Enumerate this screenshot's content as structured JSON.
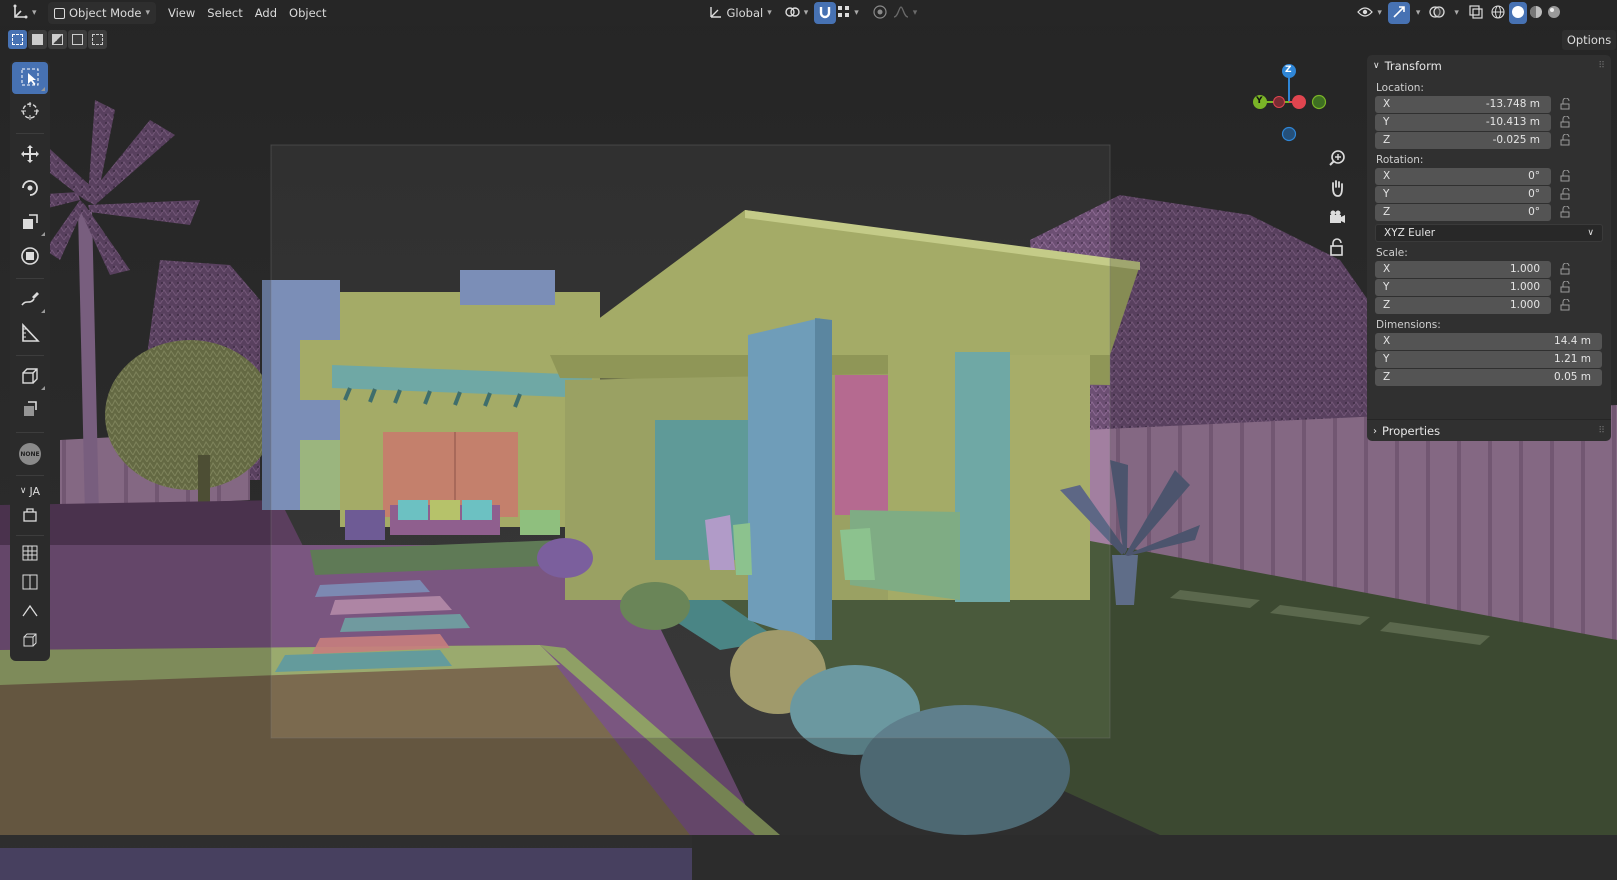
{
  "header": {
    "editor_type_icon": "axes-icon",
    "mode": "Object Mode",
    "menus": [
      "View",
      "Select",
      "Add",
      "Object"
    ],
    "transform_orientation": "Global",
    "options_button": "Options"
  },
  "toolbar": {
    "collapsed_label": "JA"
  },
  "gizmo": {
    "axis_z": "Z",
    "axis_y": "Y",
    "colors": {
      "x": "#e0454f",
      "y": "#7ab427",
      "z": "#2f86d7"
    }
  },
  "transform_panel": {
    "title": "Transform",
    "location_label": "Location:",
    "location": [
      {
        "axis": "X",
        "value": "-13.748 m"
      },
      {
        "axis": "Y",
        "value": "-10.413 m"
      },
      {
        "axis": "Z",
        "value": "-0.025 m"
      }
    ],
    "rotation_label": "Rotation:",
    "rotation": [
      {
        "axis": "X",
        "value": "0°"
      },
      {
        "axis": "Y",
        "value": "0°"
      },
      {
        "axis": "Z",
        "value": "0°"
      }
    ],
    "rotation_mode": "XYZ Euler",
    "scale_label": "Scale:",
    "scale": [
      {
        "axis": "X",
        "value": "1.000"
      },
      {
        "axis": "Y",
        "value": "1.000"
      },
      {
        "axis": "Z",
        "value": "1.000"
      }
    ],
    "dimensions_label": "Dimensions:",
    "dimensions": [
      {
        "axis": "X",
        "value": "14.4 m"
      },
      {
        "axis": "Y",
        "value": "1.21 m"
      },
      {
        "axis": "Z",
        "value": "0.05 m"
      }
    ]
  },
  "properties_panel": {
    "title": "Properties"
  },
  "colors": {
    "accent": "#4772b3",
    "header_bg": "#262626",
    "panel_bg": "#303030",
    "field_bg": "#545454"
  }
}
